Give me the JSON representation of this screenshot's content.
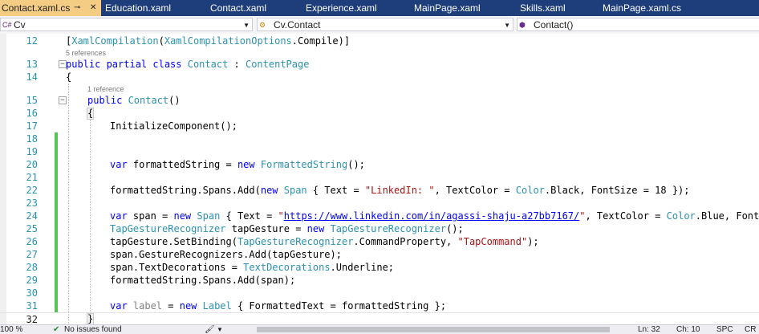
{
  "tabs": [
    {
      "label": "Contact.xaml.cs",
      "active": true
    },
    {
      "label": "Education.xaml"
    },
    {
      "label": "Contact.xaml"
    },
    {
      "label": "Experience.xaml"
    },
    {
      "label": "MainPage.xaml"
    },
    {
      "label": "Skills.xaml"
    },
    {
      "label": "MainPage.xaml.cs"
    }
  ],
  "nav": {
    "project": "Cv",
    "type": "Cv.Contact",
    "member": "Contact()"
  },
  "lens": {
    "class_refs": "5 references",
    "ctor_refs": "1 reference"
  },
  "line_numbers": [
    "12",
    "13",
    "14",
    "15",
    "16",
    "17",
    "18",
    "19",
    "20",
    "21",
    "22",
    "23",
    "24",
    "25",
    "26",
    "27",
    "28",
    "29",
    "30",
    "31",
    "32"
  ],
  "code_text": {
    "attr_open": "[",
    "attr_a": "XamlCompilation",
    "attr_b": "(",
    "attr_c": "XamlCompilationOptions",
    "attr_d": ".Compile)]",
    "l13_kw": "public partial class ",
    "l13_ty": "Contact",
    "l13_mid": " : ",
    "l13_base": "ContentPage",
    "brace_open": "{",
    "brace_close": "}",
    "l15_kw": "public ",
    "l15_ty": "Contact",
    "l15_rest": "()",
    "l17": "InitializeComponent();",
    "l20_kw": "var ",
    "l20_a": "formattedString = ",
    "l20_new": "new ",
    "l20_ty": "FormattedString",
    "l20_b": "();",
    "l22_a": "formattedString.Spans.Add(",
    "l22_new": "new ",
    "l22_ty": "Span",
    "l22_b": " { Text = ",
    "l22_st": "\"LinkedIn: \"",
    "l22_c": ", TextColor = ",
    "l22_ty2": "Color",
    "l22_d": ".Black, FontSize = 18 });",
    "l24_kw": "var ",
    "l24_a": "span = ",
    "l24_new": "new ",
    "l24_ty": "Span",
    "l24_b": " { Text = ",
    "l24_q1": "\"",
    "l24_url": "https://www.linkedin.com/in/agassi-shaju-a27bb7167/",
    "l24_q2": "\"",
    "l24_c": ", TextColor = ",
    "l24_ty2": "Color",
    "l24_d": ".Blue, FontSize",
    "l25_ty": "TapGestureRecognizer",
    "l25_a": " tapGesture = ",
    "l25_new": "new ",
    "l25_ty2": "TapGestureRecognizer",
    "l25_b": "();",
    "l26_a": "tapGesture.SetBinding(",
    "l26_ty": "TapGestureRecognizer",
    "l26_b": ".CommandProperty, ",
    "l26_st": "\"TapCommand\"",
    "l26_c": ");",
    "l27": "span.GestureRecognizers.Add(tapGesture);",
    "l28_a": "span.TextDecorations = ",
    "l28_ty": "TextDecorations",
    "l28_b": ".Underline;",
    "l29": "formattedString.Spans.Add(span);",
    "l31_kw": "var ",
    "l31_gr": "label",
    "l31_a": " = ",
    "l31_new": "new ",
    "l31_ty": "Label",
    "l31_b": " { FormattedText = formattedString };"
  },
  "status": {
    "zoom": "100 %",
    "issues": "No issues found",
    "ln": "Ln: 32",
    "ch": "Ch: 10",
    "spc": "SPC",
    "crlf": "CR"
  },
  "colors": {
    "tabbar": "#1e3e7b",
    "active_tab": "#f5cc84",
    "keyword": "#0000ff",
    "type": "#2b91af",
    "string": "#a31515",
    "change": "#57c454"
  }
}
